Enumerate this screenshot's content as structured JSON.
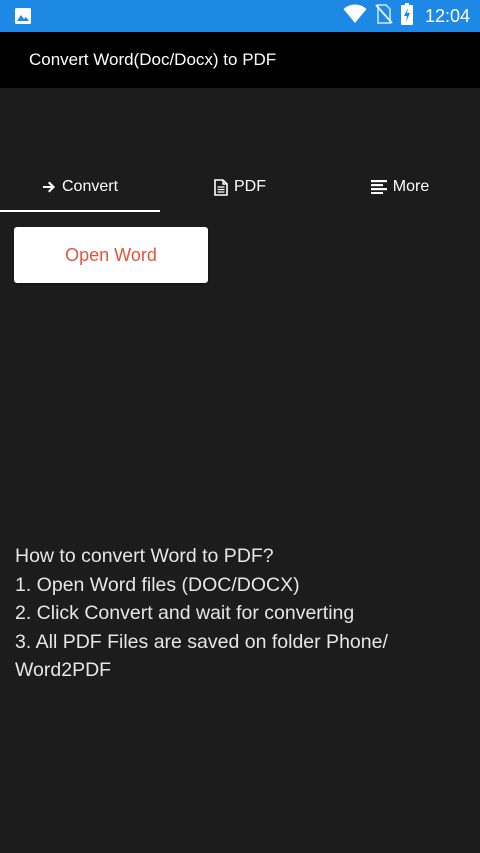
{
  "status_bar": {
    "time": "12:04",
    "icons": [
      "image-icon",
      "wifi-icon",
      "no-sim-icon",
      "battery-charging-icon"
    ]
  },
  "app_bar": {
    "title": "Convert Word(Doc/Docx) to PDF"
  },
  "tabs": [
    {
      "label": "Convert",
      "icon": "arrow-right-icon",
      "active": true
    },
    {
      "label": "PDF",
      "icon": "document-icon",
      "active": false
    },
    {
      "label": "More",
      "icon": "list-icon",
      "active": false
    }
  ],
  "open_button": {
    "label": "Open Word",
    "color": "#e4553f"
  },
  "instructions": {
    "heading": "How to convert Word to PDF?",
    "step1": "1. Open Word files (DOC/DOCX)",
    "step2": "2. Click Convert and wait for converting",
    "step3": "3. All PDF Files are saved on folder Phone/ Word2PDF"
  },
  "colors": {
    "status_bar": "#1e88e5",
    "app_bar": "#000000",
    "background": "#1c1c1d"
  }
}
